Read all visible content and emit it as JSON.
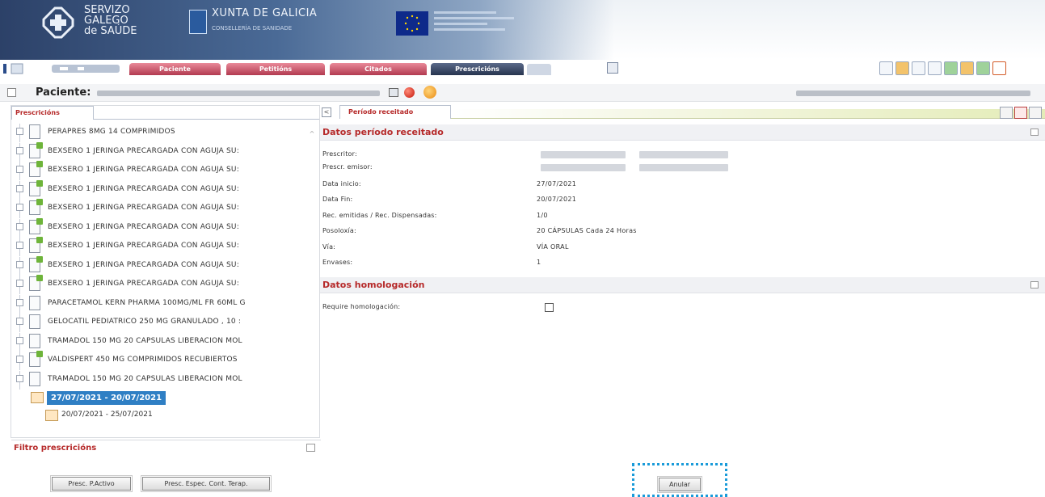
{
  "header": {
    "sergas_lines": [
      "SERVIZO",
      "GALEGO",
      "de SAÚDE"
    ],
    "xunta_title": "XUNTA DE GALICIA",
    "xunta_subtitle": "CONSELLERÍA DE SANIDADE"
  },
  "menu": {
    "tabs": [
      {
        "label": "Paciente",
        "style": "red"
      },
      {
        "label": "Petitións",
        "style": "red"
      },
      {
        "label": "Citados",
        "style": "red"
      },
      {
        "label": "Prescricións",
        "style": "dark"
      }
    ]
  },
  "patient": {
    "label": "Paciente:"
  },
  "left": {
    "tab_label": "Prescricións",
    "items": [
      {
        "label": "PERAPRES 8MG 14 COMPRIMIDOS",
        "icon": "doc-icon"
      },
      {
        "label": "BEXSERO 1 JERINGA PRECARGADA CON AGUJA SU:",
        "icon": "doc-green-icon"
      },
      {
        "label": "BEXSERO 1 JERINGA PRECARGADA CON AGUJA SU:",
        "icon": "doc-green-icon"
      },
      {
        "label": "BEXSERO 1 JERINGA PRECARGADA CON AGUJA SU:",
        "icon": "doc-green-icon"
      },
      {
        "label": "BEXSERO 1 JERINGA PRECARGADA CON AGUJA SU:",
        "icon": "doc-green-icon"
      },
      {
        "label": "BEXSERO 1 JERINGA PRECARGADA CON AGUJA SU:",
        "icon": "doc-green-icon"
      },
      {
        "label": "BEXSERO 1 JERINGA PRECARGADA CON AGUJA SU:",
        "icon": "doc-green-icon"
      },
      {
        "label": "BEXSERO 1 JERINGA PRECARGADA CON AGUJA SU:",
        "icon": "doc-green-icon"
      },
      {
        "label": "BEXSERO 1 JERINGA PRECARGADA CON AGUJA SU:",
        "icon": "doc-green-icon"
      },
      {
        "label": "PARACETAMOL KERN PHARMA 100MG/ML FR 60ML G",
        "icon": "doc-icon"
      },
      {
        "label": "GELOCATIL PEDIATRICO 250 MG GRANULADO , 10 :",
        "icon": "doc-icon"
      },
      {
        "label": "TRAMADOL 150 MG 20 CAPSULAS LIBERACION MOL",
        "icon": "doc-icon"
      },
      {
        "label": "VALDISPERT 450 MG COMPRIMIDOS RECUBIERTOS",
        "icon": "doc-green-icon"
      },
      {
        "label": "TRAMADOL 150 MG 20 CAPSULAS LIBERACION MOL",
        "icon": "doc-icon"
      }
    ],
    "periods": [
      {
        "label": "27/07/2021 - 20/07/2021",
        "selected": true
      },
      {
        "label": "20/07/2021 - 25/07/2021",
        "selected": false
      }
    ],
    "filter_title": "Filtro prescricións"
  },
  "right": {
    "tab_label": "Período receitado",
    "section1_title": "Datos período receitado",
    "fields": [
      {
        "label": "Prescritor:",
        "value": ""
      },
      {
        "label": "Prescr. emisor:",
        "value": ""
      },
      {
        "label": "Data inicio:",
        "value": "27/07/2021"
      },
      {
        "label": "Data Fin:",
        "value": "20/07/2021"
      },
      {
        "label": "Rec. emitidas / Rec. Dispensadas:",
        "value": "1/0"
      },
      {
        "label": "Posoloxía:",
        "value": "20 CÁPSULAS Cada 24 Horas"
      },
      {
        "label": "Vía:",
        "value": "VÍA ORAL"
      },
      {
        "label": "Envases:",
        "value": "1"
      }
    ],
    "section2_title": "Datos homologación",
    "homolog_label": "Require homologación:"
  },
  "buttons": {
    "presc_pactivo": "Presc. P.Activo",
    "presc_espec": "Presc. Espec. Cont. Terap.",
    "anular": "Anular"
  }
}
